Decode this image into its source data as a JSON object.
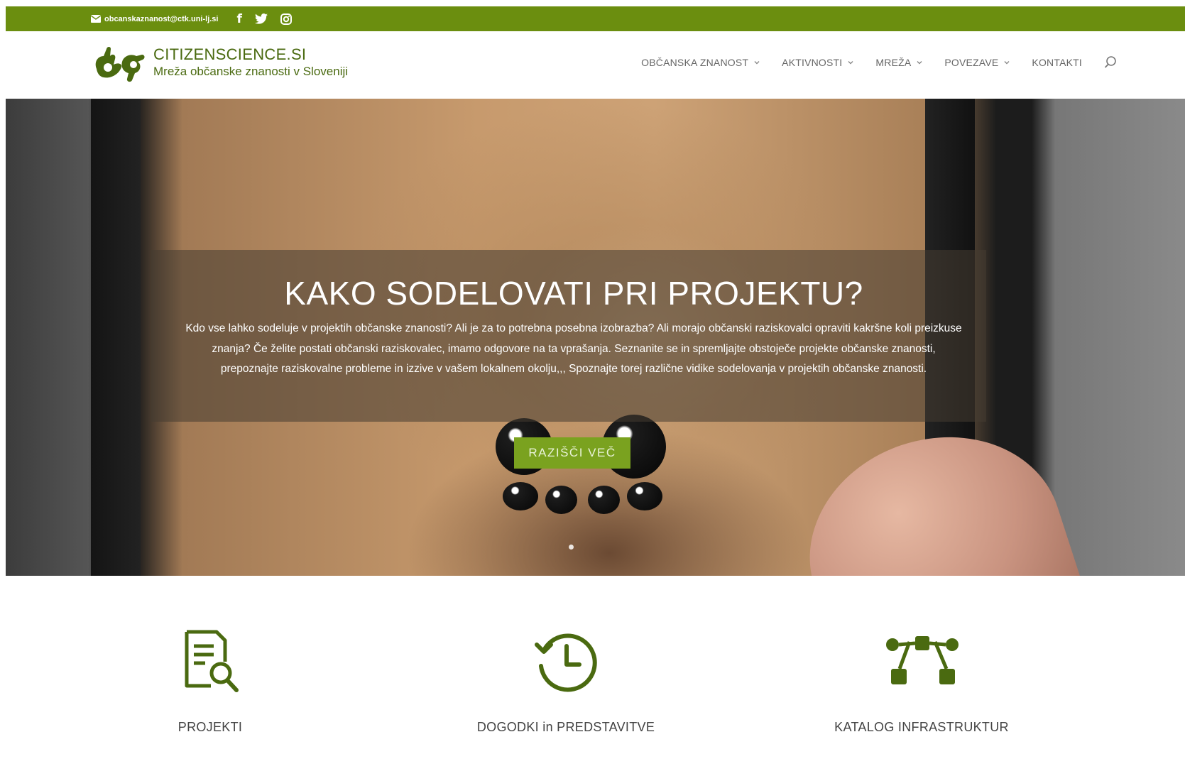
{
  "topbar": {
    "email": "obcanskaznanost@ctk.uni-lj.si",
    "social": [
      {
        "name": "facebook-icon",
        "glyph": "f"
      },
      {
        "name": "twitter-icon",
        "glyph": "twitter"
      },
      {
        "name": "instagram-icon",
        "glyph": "instagram"
      }
    ],
    "background": "#6b8e0f"
  },
  "header": {
    "site_title": "CITIZENSCIENCE.SI",
    "site_subtitle": "Mreža občanske znanosti v Sloveniji",
    "nav": [
      {
        "label": "OBČANSKA ZNANOST",
        "has_dropdown": true
      },
      {
        "label": "AKTIVNOSTI",
        "has_dropdown": true
      },
      {
        "label": "MREŽA",
        "has_dropdown": true
      },
      {
        "label": "POVEZAVE",
        "has_dropdown": true
      },
      {
        "label": "KONTAKTI",
        "has_dropdown": false
      }
    ]
  },
  "hero": {
    "title": "KAKO SODELOVATI PRI PROJEKTU?",
    "text": "Kdo vse lahko sodeluje v projektih občanske znanosti? Ali je za to potrebna posebna izobrazba? Ali morajo občanski raziskovalci opraviti kakršne koli preizkuse znanja? Če želite postati občanski raziskovalec, imamo odgovore na ta vprašanja. Seznanite se in spremljajte obstoječe projekte občanske znanosti, prepoznajte raziskovalne probleme in izzive v vašem lokalnem okolju,,, Spoznajte torej različne vidike sodelovanja v projektih občanske znanosti.",
    "button_label": "RAZIŠČI VEČ",
    "accent": "#7aa21f"
  },
  "features": [
    {
      "label": "PROJEKTI",
      "icon": "document-search-icon"
    },
    {
      "label": "DOGODKI in PREDSTAVITVE",
      "icon": "history-clock-icon"
    },
    {
      "label": "KATALOG INFRASTRUKTUR",
      "icon": "network-nodes-icon"
    }
  ],
  "colors": {
    "brand_green": "#6b8e0f",
    "icon_green": "#4a6a10"
  }
}
